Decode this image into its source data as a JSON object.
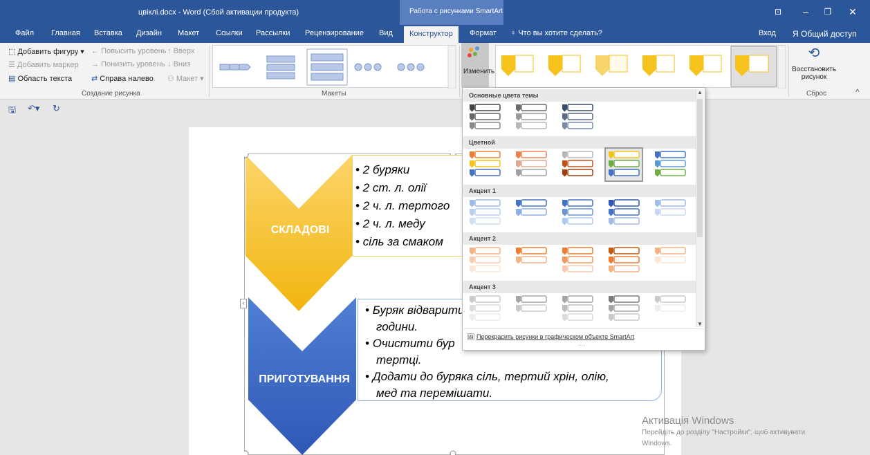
{
  "window": {
    "title": "цвіклі.docx - Word (Сбой активации продукта)",
    "context_title": "Работа с рисунками SmartArt"
  },
  "tabs": [
    {
      "label": "Файл"
    },
    {
      "label": "Главная"
    },
    {
      "label": "Вставка"
    },
    {
      "label": "Дизайн"
    },
    {
      "label": "Макет"
    },
    {
      "label": "Ссылки"
    },
    {
      "label": "Рассылки"
    },
    {
      "label": "Рецензирование"
    },
    {
      "label": "Вид"
    },
    {
      "label": "Конструктор"
    },
    {
      "label": "Формат"
    }
  ],
  "tell_me": "Что вы хотите сделать?",
  "signin": "Вход",
  "share": "Общий доступ",
  "ribbon": {
    "add_shape": "Добавить фигуру",
    "promote": "Повысить уровень",
    "move_up": "Вверх",
    "add_bullet": "Добавить маркер",
    "demote": "Понизить уровень",
    "move_down": "Вниз",
    "text_pane": "Область текста",
    "right_to_left": "Справа налево",
    "layout": "Макет",
    "group_create": "Создание рисунка",
    "group_layouts": "Макеты",
    "change_colors": "Изменить цвета",
    "reset_graphic_1": "Восстановить",
    "reset_graphic_2": "рисунок",
    "group_reset": "Сброс"
  },
  "dropdown": {
    "sections": [
      "Основные цвета темы",
      "Цветной",
      "Акцент 1",
      "Акцент 2",
      "Акцент 3"
    ],
    "recolor": "Перекрасить рисунки в графическом объекте SmartArt"
  },
  "smartart": {
    "shape1": "СКЛАДОВІ",
    "shape2": "ПРИГОТУВАННЯ",
    "bullets1": [
      "2 буряки",
      "2 ст. л. олії",
      "2 ч. л. тертого",
      "2 ч. л. меду",
      "сіль за смаком"
    ],
    "bullets2": [
      [
        "Буряк відварити",
        "години."
      ],
      [
        "Очистити бур",
        "тертці."
      ],
      [
        "Додати до буряка сіль, тертий хрін, олію,",
        "мед та перемішати."
      ]
    ]
  },
  "watermark": {
    "title": "Активація Windows",
    "line1": "Перейдіть до розділу \"Настройки\", щоб активувати",
    "line2": "Windows."
  },
  "colors": {
    "titlebar": "#2b579a",
    "yellow": "#f6c21c",
    "blue": "#3a66c4"
  }
}
